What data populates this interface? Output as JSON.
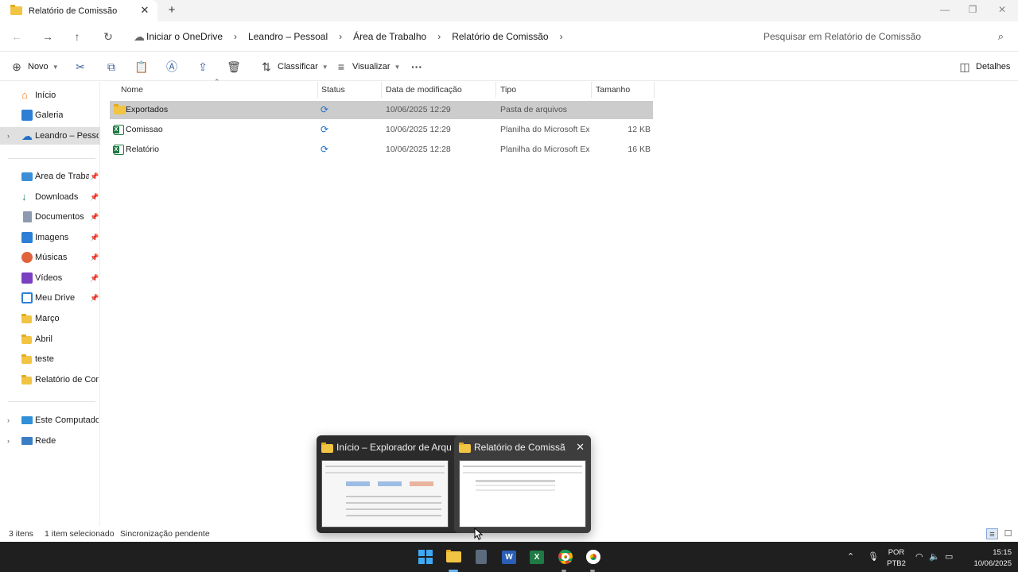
{
  "tab": {
    "title": "Relatório de Comissão"
  },
  "breadcrumb": [
    "Iniciar o OneDrive",
    "Leandro – Pessoal",
    "Área de Trabalho",
    "Relatório de Comissão"
  ],
  "search": {
    "placeholder": "Pesquisar em Relatório de Comissão"
  },
  "toolbar": {
    "new_label": "Novo",
    "sort_label": "Classificar",
    "view_label": "Visualizar",
    "details_label": "Detalhes"
  },
  "sidebar": {
    "top": [
      {
        "label": "Início",
        "icon": "home-icon"
      },
      {
        "label": "Galeria",
        "icon": "gallery-icon"
      },
      {
        "label": "Leandro – Pessoal",
        "icon": "onedrive-cloud-icon"
      }
    ],
    "quick": [
      {
        "label": "Área de Trabalho",
        "icon": "desktop-icon"
      },
      {
        "label": "Downloads",
        "icon": "download-icon"
      },
      {
        "label": "Documentos",
        "icon": "document-icon"
      },
      {
        "label": "Imagens",
        "icon": "pictures-icon"
      },
      {
        "label": "Músicas",
        "icon": "music-icon"
      },
      {
        "label": "Vídeos",
        "icon": "video-icon"
      },
      {
        "label": "Meu Drive",
        "icon": "drive-icon"
      },
      {
        "label": "Março",
        "icon": "folder-icon"
      },
      {
        "label": "Abril",
        "icon": "folder-icon"
      },
      {
        "label": "teste",
        "icon": "folder-icon"
      },
      {
        "label": "Relatório de Comissão",
        "icon": "folder-icon"
      }
    ],
    "bottom": [
      {
        "label": "Este Computador",
        "icon": "computer-icon"
      },
      {
        "label": "Rede",
        "icon": "network-icon"
      }
    ]
  },
  "columns": {
    "name": "Nome",
    "status": "Status",
    "date": "Data de modificação",
    "type": "Tipo",
    "size": "Tamanho"
  },
  "files": [
    {
      "name": "Exportados",
      "date": "10/06/2025 12:29",
      "type": "Pasta de arquivos",
      "size": "",
      "icon": "folder-icon",
      "selected": true
    },
    {
      "name": "Comissao",
      "date": "10/06/2025 12:29",
      "type": "Planilha do Microsoft Ex...",
      "size": "12 KB",
      "icon": "excel-file-icon",
      "selected": false
    },
    {
      "name": "Relatório",
      "date": "10/06/2025 12:28",
      "type": "Planilha do Microsoft Ex...",
      "size": "16 KB",
      "icon": "excel-file-icon",
      "selected": false
    }
  ],
  "status": {
    "count": "3 itens",
    "selected": "1 item selecionado",
    "sync": "Sincronização pendente"
  },
  "thumbnails": [
    {
      "title": "Início – Explorador de Arquivos"
    },
    {
      "title": "Relatório de Comissão"
    }
  ],
  "tray": {
    "lang_top": "POR",
    "lang_bottom": "PTB2",
    "time": "15:15",
    "date": "10/06/2025"
  },
  "colors": {
    "accent": "#1f6fc7",
    "folder": "#f2c443",
    "excel": "#1f7a46",
    "taskbar": "#1f1f1f"
  }
}
